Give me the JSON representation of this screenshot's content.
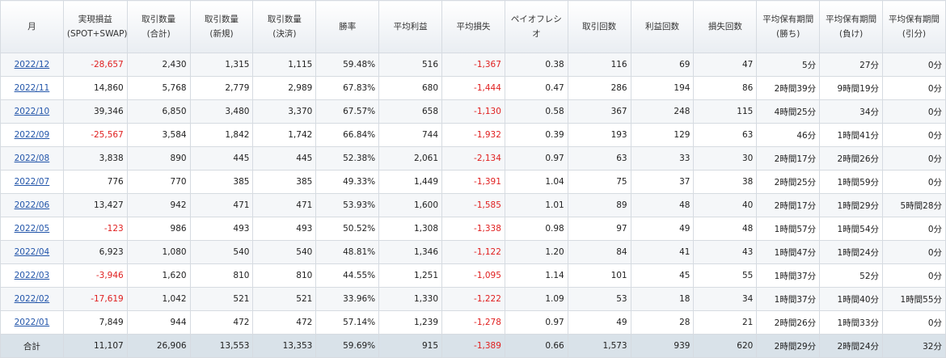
{
  "columns": [
    "月",
    "実現損益\n(SPOT+SWAP)",
    "取引数量\n(合計)",
    "取引数量\n(新規)",
    "取引数量\n(決済)",
    "勝率",
    "平均利益",
    "平均損失",
    "ペイオフレシオ",
    "取引回数",
    "利益回数",
    "損失回数",
    "平均保有期間\n(勝ち)",
    "平均保有期間\n(負け)",
    "平均保有期間\n(引分)"
  ],
  "rows": [
    [
      "2022/12",
      "-28,657",
      "2,430",
      "1,315",
      "1,115",
      "59.48%",
      "516",
      "-1,367",
      "0.38",
      "116",
      "69",
      "47",
      "5分",
      "27分",
      "0分"
    ],
    [
      "2022/11",
      "14,860",
      "5,768",
      "2,779",
      "2,989",
      "67.83%",
      "680",
      "-1,444",
      "0.47",
      "286",
      "194",
      "86",
      "2時間39分",
      "9時間19分",
      "0分"
    ],
    [
      "2022/10",
      "39,346",
      "6,850",
      "3,480",
      "3,370",
      "67.57%",
      "658",
      "-1,130",
      "0.58",
      "367",
      "248",
      "115",
      "4時間25分",
      "34分",
      "0分"
    ],
    [
      "2022/09",
      "-25,567",
      "3,584",
      "1,842",
      "1,742",
      "66.84%",
      "744",
      "-1,932",
      "0.39",
      "193",
      "129",
      "63",
      "46分",
      "1時間41分",
      "0分"
    ],
    [
      "2022/08",
      "3,838",
      "890",
      "445",
      "445",
      "52.38%",
      "2,061",
      "-2,134",
      "0.97",
      "63",
      "33",
      "30",
      "2時間17分",
      "2時間26分",
      "0分"
    ],
    [
      "2022/07",
      "776",
      "770",
      "385",
      "385",
      "49.33%",
      "1,449",
      "-1,391",
      "1.04",
      "75",
      "37",
      "38",
      "2時間25分",
      "1時間59分",
      "0分"
    ],
    [
      "2022/06",
      "13,427",
      "942",
      "471",
      "471",
      "53.93%",
      "1,600",
      "-1,585",
      "1.01",
      "89",
      "48",
      "40",
      "2時間17分",
      "1時間29分",
      "5時間28分"
    ],
    [
      "2022/05",
      "-123",
      "986",
      "493",
      "493",
      "50.52%",
      "1,308",
      "-1,338",
      "0.98",
      "97",
      "49",
      "48",
      "1時間57分",
      "1時間54分",
      "0分"
    ],
    [
      "2022/04",
      "6,923",
      "1,080",
      "540",
      "540",
      "48.81%",
      "1,346",
      "-1,122",
      "1.20",
      "84",
      "41",
      "43",
      "1時間47分",
      "1時間24分",
      "0分"
    ],
    [
      "2022/03",
      "-3,946",
      "1,620",
      "810",
      "810",
      "44.55%",
      "1,251",
      "-1,095",
      "1.14",
      "101",
      "45",
      "55",
      "1時間37分",
      "52分",
      "0分"
    ],
    [
      "2022/02",
      "-17,619",
      "1,042",
      "521",
      "521",
      "33.96%",
      "1,330",
      "-1,222",
      "1.09",
      "53",
      "18",
      "34",
      "1時間37分",
      "1時間40分",
      "1時間55分"
    ],
    [
      "2022/01",
      "7,849",
      "944",
      "472",
      "472",
      "57.14%",
      "1,239",
      "-1,278",
      "0.97",
      "49",
      "28",
      "21",
      "2時間26分",
      "1時間33分",
      "0分"
    ]
  ],
  "total": [
    "合計",
    "11,107",
    "26,906",
    "13,553",
    "13,353",
    "59.69%",
    "915",
    "-1,389",
    "0.66",
    "1,573",
    "939",
    "620",
    "2時間29分",
    "2時間24分",
    "32分"
  ],
  "colors": {
    "negative": "#e02020",
    "link": "#2255aa",
    "total_bg": "#d9e2e9"
  }
}
